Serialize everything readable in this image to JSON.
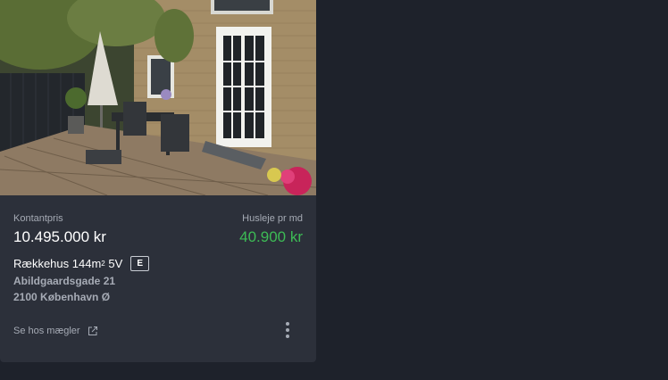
{
  "listing": {
    "price_label": "Kontantpris",
    "price": "10.495.000 kr",
    "rent_label": "Husleje pr md",
    "rent": "40.900 kr",
    "type": "Rækkehus 144m",
    "area_sup": "2",
    "rooms": "5V",
    "energy_label": "E",
    "address_line1": "Abildgaardsgade 21",
    "address_line2": "2100 København Ø",
    "broker_link": "Se hos mægler"
  },
  "icons": {
    "external": "external-link-icon",
    "more": "more-vertical-icon"
  },
  "colors": {
    "page_bg": "#1e222b",
    "card_bg": "#2c303a",
    "rent": "#3dbb55",
    "muted": "#a6abb5"
  }
}
